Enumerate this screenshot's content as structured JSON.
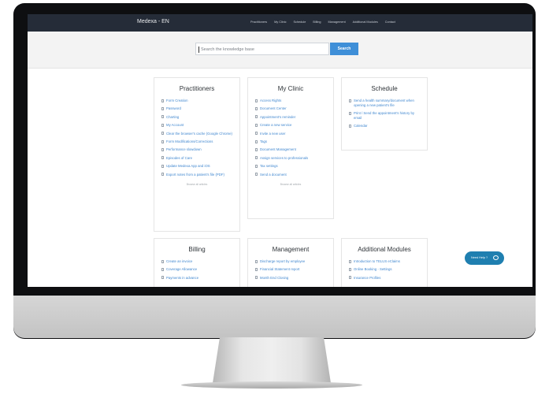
{
  "navbar": {
    "brand": "Medexa - EN",
    "links": [
      "Practitioners",
      "My Clinic",
      "Schedule",
      "Billing",
      "Management",
      "Additional Modules",
      "Contact"
    ]
  },
  "search": {
    "placeholder": "Search the knowledge base",
    "button": "Search"
  },
  "categories": [
    {
      "title": "Practitioners",
      "articles": [
        "Form Creation",
        "Password",
        "Charting",
        "My Account",
        "Clear the browser's cache (Google Chrome)",
        "Form Modifications/Corrections",
        "Performance slowdown",
        "Episodes of Care",
        "Update Medexa App and iOS",
        "Export notes from a patient's file (PDF)"
      ],
      "browse": "Browse all articles"
    },
    {
      "title": "My Clinic",
      "articles": [
        "Access Rights",
        "Document Center",
        "Appointment's reminder",
        "Create a new service",
        "Invite a new user",
        "Tags",
        "Document Management",
        "Assign services to professionals",
        "Tax settings",
        "Send a document"
      ],
      "browse": "Browse all articles"
    },
    {
      "title": "Schedule",
      "articles": [
        "Send a health summary/document when opening a new patient's file",
        "Print / Send the appointment's history by email",
        "Calendar"
      ]
    },
    {
      "title": "Billing",
      "articles": [
        "Create an invoice",
        "Coverage Allowance",
        "Payments in advance"
      ]
    },
    {
      "title": "Management",
      "articles": [
        "Discharge report by employee",
        "Financial Statement report",
        "Month End Closing"
      ]
    },
    {
      "title": "Additional Modules",
      "articles": [
        "Introduction to TELUS eClaims",
        "Online Booking - Settings",
        "Insurance Profiles"
      ]
    }
  ],
  "help": {
    "label": "Need Help ?"
  }
}
